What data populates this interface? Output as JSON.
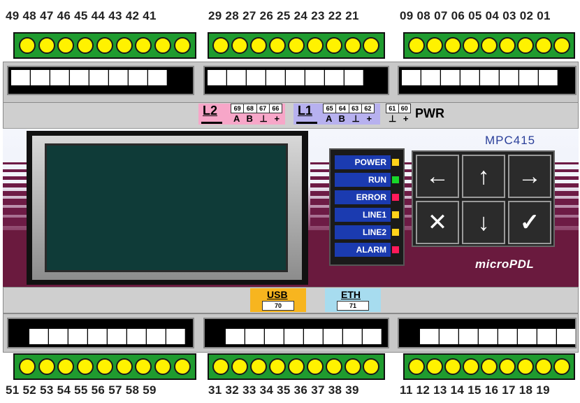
{
  "top_numbers": {
    "left": "49 48 47 46 45 44 43 42 41",
    "mid": "29 28 27 26 25 24 23 22 21",
    "right": "09 08 07 06 05 04 03 02 01"
  },
  "bottom_numbers": {
    "left": "51 52 53 54 55 56 57 58 59",
    "mid": "31 32 33 34 35 36 37 38 39",
    "right": "11 12 13 14 15 16 17 18 19"
  },
  "ports": {
    "l2": {
      "label": "L2",
      "pins": [
        "69",
        "68",
        "67",
        "66"
      ],
      "sub": "A B ⊥ +"
    },
    "l1": {
      "label": "L1",
      "pins": [
        "65",
        "64",
        "63",
        "62"
      ],
      "sub": "A B ⊥ +"
    },
    "pwr": {
      "label": "PWR",
      "pins": [
        "61",
        "60"
      ],
      "sub": "⊥ +"
    },
    "usb": {
      "label": "USB",
      "pin": "70"
    },
    "eth": {
      "label": "ETH",
      "pin": "71"
    }
  },
  "model": "MPC415",
  "brand": "microPDL",
  "leds": [
    {
      "label": "POWER",
      "color": "#ffd21a"
    },
    {
      "label": "RUN",
      "color": "#18d62a"
    },
    {
      "label": "ERROR",
      "color": "#ff1a5a"
    },
    {
      "label": "LINE1",
      "color": "#ffd21a"
    },
    {
      "label": "LINE2",
      "color": "#ffd21a"
    },
    {
      "label": "ALARM",
      "color": "#ff1a5a"
    }
  ],
  "keys": {
    "left": "←",
    "up": "↑",
    "right": "→",
    "cancel": "✕",
    "down": "↓",
    "ok": "✓"
  },
  "colors": {
    "terminal": "#1f9b2f",
    "terminal_hole": "#fff200",
    "body": "#6a1a3e",
    "l2_bg": "#f7a6c8",
    "l1_bg": "#b7b1ef",
    "usb_bg": "#f7b51f",
    "eth_bg": "#a7dcef"
  }
}
